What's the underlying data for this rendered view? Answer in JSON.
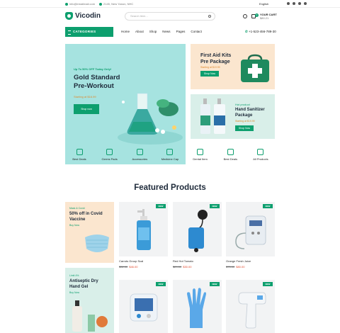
{
  "topbar": {
    "email": "info@emailmail.com",
    "address": "2145, New Yanon, NHC",
    "language": "English"
  },
  "header": {
    "brand": "Vicodin",
    "search_placeholder": "Search item...",
    "cart_label": "YOUR CART",
    "cart_amount": "$80.21",
    "cart_count": "0"
  },
  "nav": {
    "categories_label": "CATEGORIES",
    "items": [
      "Home",
      "About",
      "Shop",
      "News",
      "Pages",
      "Contact"
    ],
    "phone": "+1-523-456-789-30"
  },
  "hero": {
    "tag": "Up To 50% OFF Today Only!",
    "title_line1": "Gold Standard",
    "title_line2": "Pre-Workout",
    "price": "Starting at $16.99",
    "button": "Shop now"
  },
  "banners": [
    {
      "small": "",
      "title_line1": "First Aid Kits",
      "title_line2": "Pre Package",
      "price": "Starting at $19.99",
      "button": "Shop Now"
    },
    {
      "small": "Hot product",
      "title_line1": "Hand Sanitizer",
      "title_line2": "Package",
      "price": "Starting at $19.99",
      "button": "Shop Now"
    }
  ],
  "categories": [
    "Best Deals",
    "Germs Pads",
    "Accessories",
    "Medicine Cap",
    "Dental Item",
    "Best Deals",
    "All Products"
  ],
  "featured_title": "Featured Products",
  "promos": [
    {
      "small": "Mask & Covid",
      "title_line1": "50% off in Covid",
      "title_line2": "Vaccine",
      "link": "Buy Now"
    },
    {
      "small": "Limit 4%",
      "title_line1": "Antiseptic Dry",
      "title_line2": "Hand Gel",
      "link": "Buy Now"
    }
  ],
  "products": [
    {
      "name": "Carrots Group Scal",
      "old_price": "$32.00",
      "price": "$46.00",
      "badge": "NEW"
    },
    {
      "name": "Red Hot Tomato",
      "old_price": "$29.00",
      "price": "$30.00",
      "badge": "NEW"
    },
    {
      "name": "Orange Fresh Juice",
      "old_price": "$75.00",
      "price": "$80.00",
      "badge": "NEW"
    },
    {
      "name": "",
      "old_price": "",
      "price": "",
      "badge": "NEW"
    },
    {
      "name": "",
      "old_price": "",
      "price": "",
      "badge": "NEW"
    },
    {
      "name": "",
      "old_price": "",
      "price": "",
      "badge": "NEW"
    }
  ]
}
